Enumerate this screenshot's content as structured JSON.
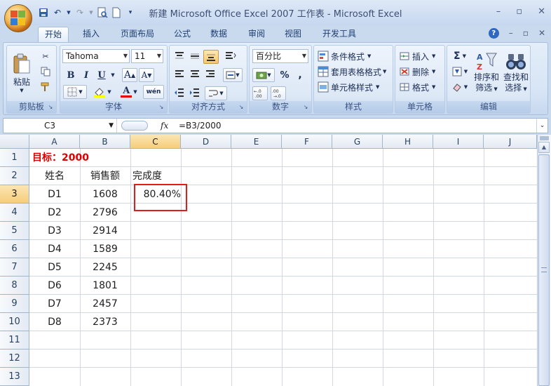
{
  "window": {
    "title": "新建 Microsoft Office Excel 2007 工作表 - Microsoft Excel"
  },
  "ribbon_tabs": [
    "开始",
    "插入",
    "页面布局",
    "公式",
    "数据",
    "审阅",
    "视图",
    "开发工具"
  ],
  "ribbon": {
    "clipboard": {
      "label": "剪贴板",
      "paste": "粘贴"
    },
    "font": {
      "label": "字体",
      "font_name": "Tahoma",
      "font_size": "11",
      "bold": "B",
      "italic": "I",
      "underline": "U",
      "grow": "A",
      "shrink": "A",
      "font_color": "A",
      "phonetic": "wén"
    },
    "alignment": {
      "label": "对齐方式"
    },
    "number": {
      "label": "数字",
      "format": "百分比"
    },
    "styles": {
      "label": "样式",
      "conditional": "条件格式",
      "table": "套用表格格式",
      "cell_styles": "单元格样式"
    },
    "cells": {
      "label": "单元格",
      "insert": "插入",
      "delete": "删除",
      "format": "格式"
    },
    "editing": {
      "label": "编辑",
      "sort": "排序和",
      "sort2": "筛选",
      "find": "查找和",
      "find2": "选择"
    }
  },
  "formula_bar": {
    "name_box": "C3",
    "fx": "fx",
    "formula": "=B3/2000"
  },
  "columns": [
    "A",
    "B",
    "C",
    "D",
    "E",
    "F",
    "G",
    "H",
    "I",
    "J"
  ],
  "rows": [
    "1",
    "2",
    "3",
    "4",
    "5",
    "6",
    "7",
    "8",
    "9",
    "10",
    "11",
    "12",
    "13"
  ],
  "sheet": {
    "target_label": "目标：2000",
    "headers": {
      "name": "姓名",
      "sales": "销售额",
      "completion": "完成度"
    },
    "records": [
      {
        "name": "D1",
        "sales": "1608",
        "completion": "80.40%"
      },
      {
        "name": "D2",
        "sales": "2796"
      },
      {
        "name": "D3",
        "sales": "2914"
      },
      {
        "name": "D4",
        "sales": "1589"
      },
      {
        "name": "D5",
        "sales": "2245"
      },
      {
        "name": "D6",
        "sales": "1801"
      },
      {
        "name": "D7",
        "sales": "2457"
      },
      {
        "name": "D8",
        "sales": "2373"
      }
    ],
    "selected_cell": "C3"
  },
  "colors": {
    "target_text": "#e00000",
    "highlight_box": "#e21b1b",
    "header_selected": "#f6cd7a"
  }
}
